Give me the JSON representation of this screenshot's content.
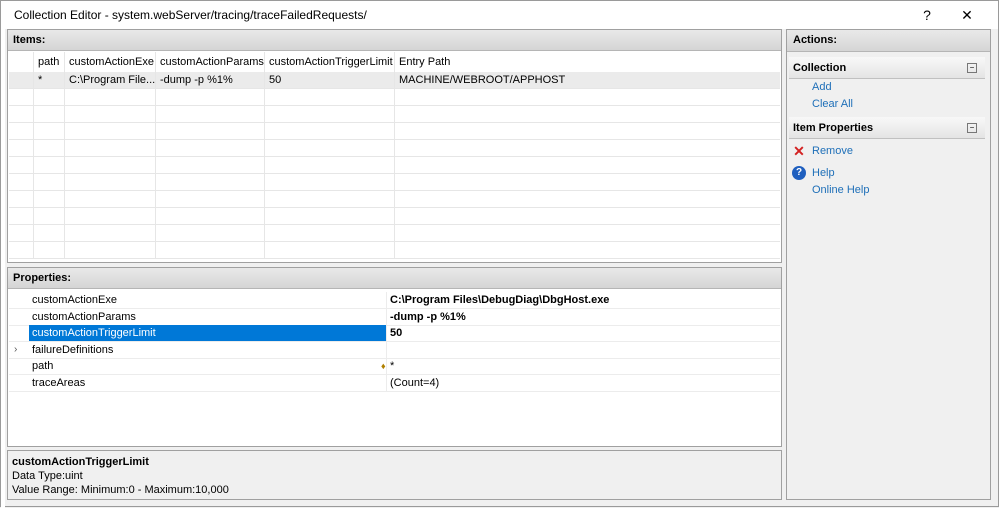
{
  "window": {
    "title": "Collection Editor - system.webServer/tracing/traceFailedRequests/",
    "help_glyph": "?",
    "close_glyph": "✕"
  },
  "items": {
    "header": "Items:",
    "columns": [
      "",
      "path",
      "customActionExe",
      "customActionParams",
      "customActionTriggerLimit",
      "Entry Path"
    ],
    "rows": [
      [
        "",
        "*",
        "C:\\Program File...",
        "-dump -p %1%",
        "50",
        "MACHINE/WEBROOT/APPHOST"
      ]
    ]
  },
  "properties": {
    "header": "Properties:",
    "rows": [
      {
        "name": "customActionExe",
        "value": "C:\\Program Files\\DebugDiag\\DbgHost.exe",
        "bold": true,
        "expander": "",
        "pin": ""
      },
      {
        "name": "customActionParams",
        "value": "-dump -p %1%",
        "bold": true,
        "expander": "",
        "pin": ""
      },
      {
        "name": "customActionTriggerLimit",
        "value": "50",
        "bold": true,
        "expander": "",
        "pin": ""
      },
      {
        "name": "failureDefinitions",
        "value": "",
        "bold": false,
        "expander": "›",
        "pin": ""
      },
      {
        "name": "path",
        "value": "*",
        "bold": false,
        "expander": "",
        "pin": "♦"
      },
      {
        "name": "traceAreas",
        "value": "(Count=4)",
        "bold": false,
        "expander": "",
        "pin": ""
      }
    ],
    "selected_index": 2
  },
  "description": {
    "name": "customActionTriggerLimit",
    "data_type": "Data Type:uint",
    "value_range": " Value Range: Minimum:0 - Maximum:10,000"
  },
  "actions": {
    "header": "Actions:",
    "collection_section": "Collection",
    "add": "Add",
    "clear_all": "Clear All",
    "item_properties_section": "Item Properties",
    "remove": "Remove",
    "help": "Help",
    "online_help": "Online Help",
    "collapse_glyph": "−",
    "remove_glyph": "✕",
    "help_glyph": "?"
  },
  "colors": {
    "selection": "#0078d7",
    "link": "#1e6fb8",
    "remove": "#d32222"
  }
}
